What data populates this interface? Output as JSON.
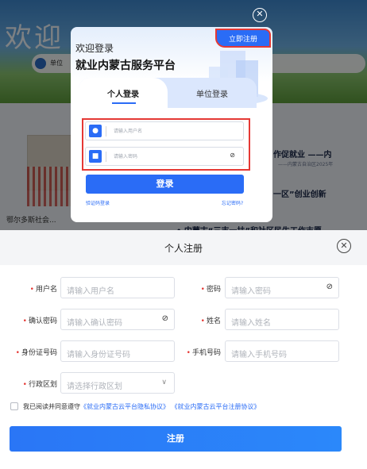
{
  "background": {
    "banner_text": "欢迎",
    "nav_text": "单位",
    "news": [
      "作促就业 ——内",
      "一区”创业创新",
      "• 内蒙古“三支一扶”和社区民生工作志愿"
    ],
    "news_sub": "——内蒙古自治区2025年",
    "bottom_text": "鄂尔多斯社会...",
    "close_icon": "close-circle-icon"
  },
  "login": {
    "welcome": "欢迎登录",
    "platform": "就业内蒙古服务平台",
    "register_now": "立即注册",
    "tabs": [
      "个人登录",
      "单位登录"
    ],
    "username_placeholder": "请输入用户名",
    "password_placeholder": "请输入密码",
    "login_button": "登录",
    "code_login": "验证码登录",
    "forgot": "忘记密码?",
    "accent": "#2a6cf6",
    "highlight": "#e53935"
  },
  "register": {
    "title": "个人注册",
    "fields": [
      {
        "label": "用户名",
        "placeholder": "请输入用户名"
      },
      {
        "label": "密码",
        "placeholder": "请输入密码"
      },
      {
        "label": "确认密码",
        "placeholder": "请输入确认密码"
      },
      {
        "label": "姓名",
        "placeholder": "请输入姓名"
      },
      {
        "label": "身份证号码",
        "placeholder": "请输入身份证号码"
      },
      {
        "label": "手机号码",
        "placeholder": "请输入手机号码"
      },
      {
        "label": "行政区划",
        "placeholder": "请选择行政区划"
      }
    ],
    "agree_prefix": "我已阅读并同意遵守",
    "privacy_link": "《就业内蒙古云平台隐私协议》",
    "terms_link": "《就业内蒙古云平台注册协议》",
    "submit": "注册"
  }
}
